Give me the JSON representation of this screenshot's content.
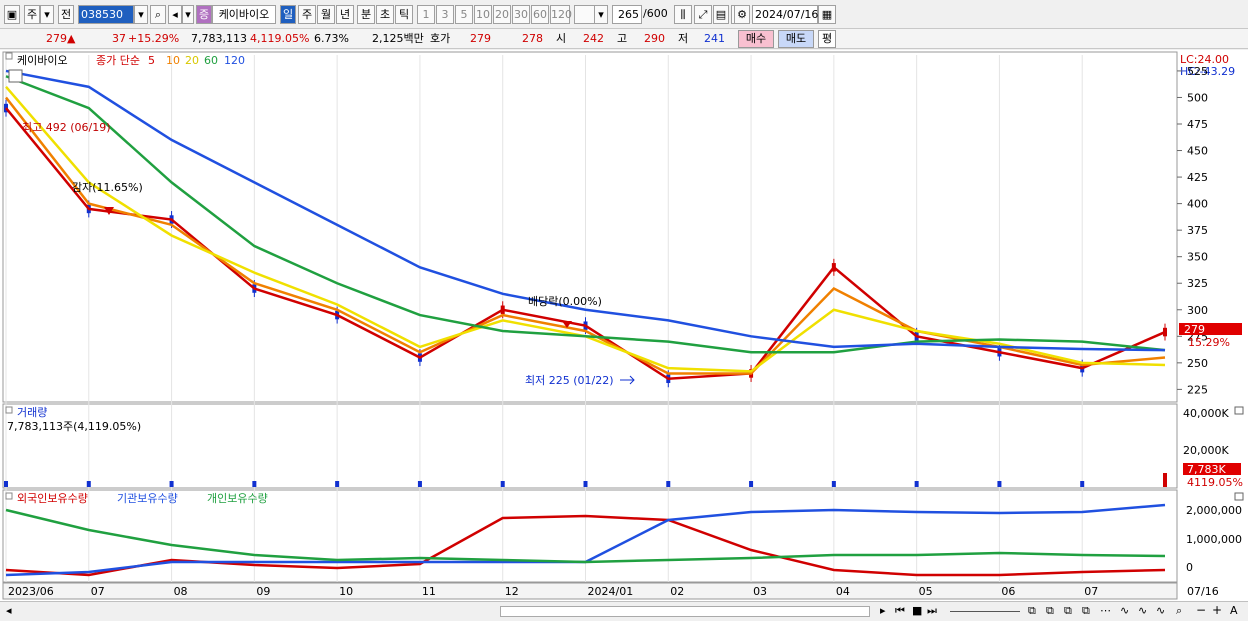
{
  "toolbar": {
    "code": "038530",
    "period_buttons": [
      "일",
      "주",
      "월",
      "년",
      "분",
      "초",
      "틱"
    ],
    "interval_buttons": [
      "1",
      "3",
      "5",
      "10",
      "20",
      "30",
      "60",
      "120"
    ],
    "count": "265",
    "count_total": "/600",
    "date": "2024/07/16",
    "mode_labels": [
      "주",
      "전"
    ],
    "stock_badge": "증",
    "stock_name": "케이바이오"
  },
  "quote": {
    "price": "279",
    "change": "37",
    "change_pct": "+15.29%",
    "volume": "7,783,113",
    "volume_ratio": "4,119.05%",
    "turnover": "6.73%",
    "amount": "2,125백만",
    "hoga_label": "호가",
    "ask": "279",
    "bid": "278",
    "open_label": "시",
    "open": "242",
    "high_label": "고",
    "high": "290",
    "low_label": "저",
    "low": "241",
    "buy_button": "매수",
    "sell_button": "매도",
    "eval_button": "평"
  },
  "legend": {
    "name": "케이바이오",
    "ma_title": "종가 단순",
    "ma_periods": [
      {
        "label": "5",
        "color": "#d00000"
      },
      {
        "label": "10",
        "color": "#f08000"
      },
      {
        "label": "20",
        "color": "#f0e000"
      },
      {
        "label": "60",
        "color": "#20a040"
      },
      {
        "label": "120",
        "color": "#2050e0"
      }
    ],
    "lc": "LC:24.00",
    "hc": "HC:-43.29"
  },
  "annotations": {
    "high": "최고 492 (06/19)",
    "capital_reduction": "감자(11.65%)",
    "dividend": "배당락(0.00%)",
    "low": "최저 225 (01/22)"
  },
  "price_axis": [
    "525",
    "500",
    "475",
    "450",
    "425",
    "400",
    "375",
    "350",
    "325",
    "300",
    "275",
    "250",
    "225"
  ],
  "price_tag": "279",
  "pct_tag": "15.29%",
  "volume_panel": {
    "title": "거래량",
    "info": "7,783,113주(4,119.05%)",
    "axis": [
      "40,000K",
      "20,000K"
    ],
    "tag": "7,783K",
    "tag2": "4119.05%"
  },
  "holdings_panel": {
    "labels": [
      "외국인보유수량",
      "기관보유수량",
      "개인보유수량"
    ],
    "colors": [
      "#d00000",
      "#2050e0",
      "#20a040"
    ],
    "axis": [
      "2,000,000",
      "1,000,000",
      "0"
    ]
  },
  "x_axis": [
    "2023/06",
    "07",
    "08",
    "09",
    "10",
    "11",
    "12",
    "2024/01",
    "02",
    "03",
    "04",
    "05",
    "06",
    "07",
    "07/16"
  ],
  "chart_data": {
    "type": "line",
    "title": "케이바이오",
    "x": [
      "2023/06",
      "07",
      "08",
      "09",
      "10",
      "11",
      "12",
      "2024/01",
      "02",
      "03",
      "04",
      "05",
      "06",
      "07",
      "07/16"
    ],
    "ylim": [
      215,
      540
    ],
    "series": [
      {
        "name": "5",
        "values": [
          490,
          395,
          385,
          320,
          295,
          255,
          300,
          285,
          235,
          240,
          340,
          275,
          260,
          245,
          279
        ]
      },
      {
        "name": "10",
        "values": [
          500,
          400,
          380,
          325,
          300,
          260,
          295,
          280,
          240,
          240,
          320,
          280,
          265,
          248,
          255
        ]
      },
      {
        "name": "20",
        "values": [
          510,
          420,
          370,
          335,
          305,
          265,
          290,
          275,
          245,
          242,
          300,
          280,
          268,
          250,
          248
        ]
      },
      {
        "name": "60",
        "values": [
          520,
          490,
          420,
          360,
          325,
          295,
          280,
          275,
          270,
          260,
          260,
          270,
          272,
          270,
          262
        ]
      },
      {
        "name": "120",
        "values": [
          525,
          510,
          460,
          420,
          380,
          340,
          315,
          300,
          290,
          275,
          265,
          268,
          265,
          263,
          262
        ]
      }
    ]
  }
}
